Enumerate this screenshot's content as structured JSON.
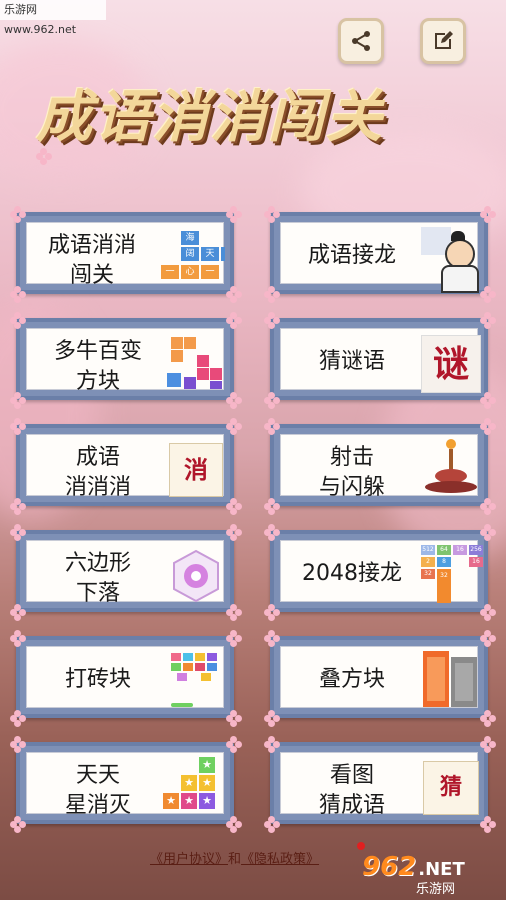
{
  "watermark": "乐游网 www.962.net",
  "title": "成语消消闯关",
  "games": [
    {
      "id": "chengyu-xiaoxiao-chuangguan",
      "line1": "成语消消",
      "line2": "闯关"
    },
    {
      "id": "chengyu-jielong",
      "line1": "成语接龙",
      "line2": ""
    },
    {
      "id": "duoniu-baibian-fangkuai",
      "line1": "多牛百变",
      "line2": "方块"
    },
    {
      "id": "caimiyu",
      "line1": "猜谜语",
      "line2": ""
    },
    {
      "id": "chengyu-xiaoxiaoxiao",
      "line1": "成语",
      "line2": "消消消"
    },
    {
      "id": "sheji-yu-shanduo",
      "line1": "射击",
      "line2": "与闪躲"
    },
    {
      "id": "liubianxing-xialuo",
      "line1": "六边形",
      "line2": "下落"
    },
    {
      "id": "2048-jielong",
      "line1": "2048接龙",
      "line2": ""
    },
    {
      "id": "dazhuankuai",
      "line1": "打砖块",
      "line2": ""
    },
    {
      "id": "diefangkuai",
      "line1": "叠方块",
      "line2": ""
    },
    {
      "id": "tiantian-xingxiaomie",
      "line1": "天天",
      "line2": "星消灭"
    },
    {
      "id": "kantu-cai-chengyu",
      "line1": "看图",
      "line2": "猜成语"
    }
  ],
  "thumbs": {
    "grid1": [
      "海",
      "阔",
      "天",
      "空",
      "一",
      "心",
      "一",
      "意"
    ],
    "xiao": "消",
    "mi": "谜",
    "cai": "猜",
    "n2048": [
      "512",
      "2",
      "32",
      "64",
      "8",
      "32",
      "16",
      "256",
      "16"
    ]
  },
  "footer": {
    "agreement": "《用户协议》",
    "and": "和",
    "privacy": "《隐私政策》"
  },
  "brand": {
    "logo": "962",
    "suffix": ".NET",
    "cn": "乐游网"
  },
  "icons": {
    "share": "share-icon",
    "edit": "edit-icon"
  },
  "colors": {
    "card_border": "#6b7fa8",
    "title": "#f3d79a"
  }
}
